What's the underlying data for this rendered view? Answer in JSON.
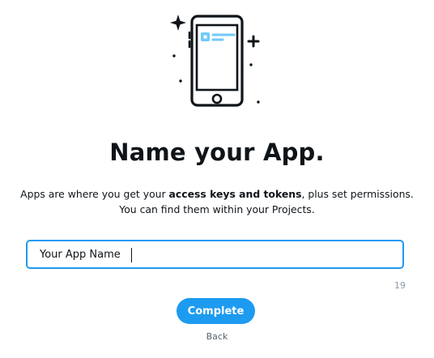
{
  "dialog": {
    "title": "Name your App.",
    "description": {
      "prefix": "Apps are where you get your ",
      "emphasis": "access keys and tokens",
      "suffix": ", plus set permissions.",
      "line2": "You can find them within your Projects."
    },
    "app_name_input": {
      "value": "Your App Name",
      "placeholder": ""
    },
    "char_counter": "19",
    "complete_button": "Complete",
    "back_link": "Back"
  },
  "illustration": {
    "icon": "smartphone-icon",
    "accent_color": "#71c9f8",
    "line_color": "#0f1419"
  },
  "colors": {
    "primary": "#1d9bf0",
    "text": "#0f1419",
    "muted": "#8b98a5",
    "link": "#536471"
  }
}
